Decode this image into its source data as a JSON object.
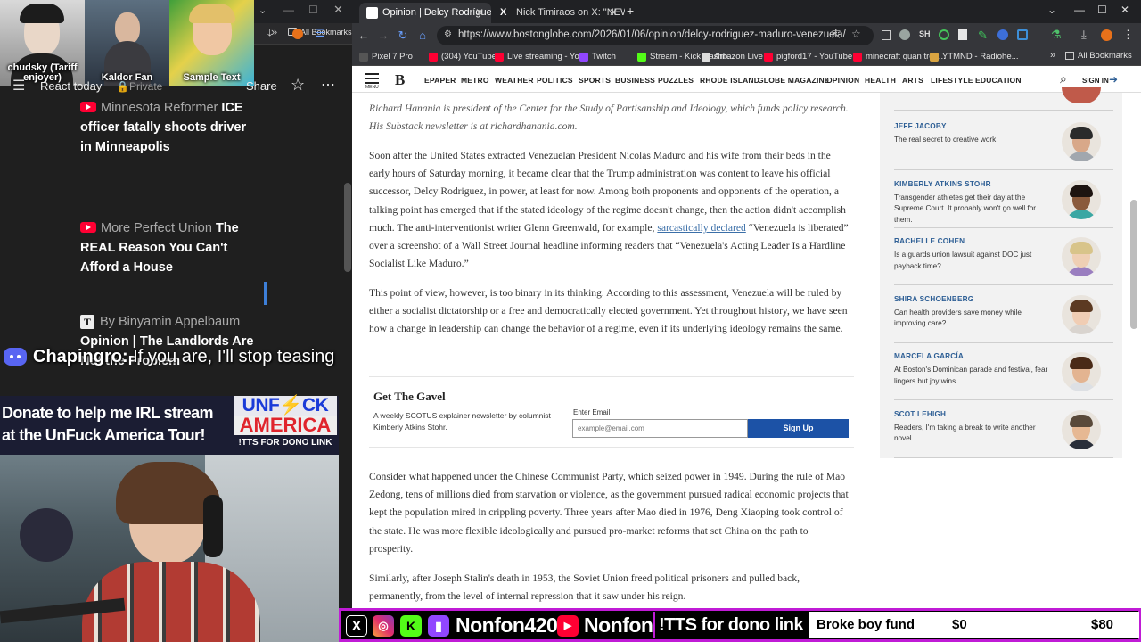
{
  "left_window": {
    "thumbnails": [
      {
        "caption": "chudsky (Tariff enjoyer)"
      },
      {
        "caption": "Kaldor Fan"
      },
      {
        "caption": "Sample Text"
      }
    ],
    "bookmarks_label": "All Bookmarks",
    "youtube_bar": {
      "react_label": "React today",
      "private_label": "Private",
      "share_label": "Share"
    },
    "feed": [
      {
        "source": "Minnesota Reformer",
        "title": "ICE officer fatally shoots driver in Minneapolis"
      },
      {
        "source": "More Perfect Union",
        "title": "The REAL Reason You Can't Afford a House"
      },
      {
        "source": "By Binyamin Appelbaum",
        "title": "Opinion | The Landlords Are Not the Problem"
      }
    ]
  },
  "overlays": {
    "chat_user": "Chapingro:",
    "chat_message": "If you are, I'll stop teasing",
    "donate_line1": "Donate to help me  IRL stream",
    "donate_line2": "at the UnFuck America Tour!",
    "logo_line1": "UNF⚡CK",
    "logo_line2": "AMERICA",
    "tts_label": "!TTS FOR DONO LINK"
  },
  "browser": {
    "tabs": [
      {
        "label": "Opinion | Delcy Rodríguez and",
        "active": true
      },
      {
        "label": "Nick Timiraos on X: \"NEW: Trur",
        "active": false
      }
    ],
    "url": "https://www.bostonglobe.com/2026/01/06/opinion/delcy-rodriguez-maduro-venezuela/",
    "bookmarks": [
      {
        "label": "Pixel 7 Pro",
        "color": "#555555"
      },
      {
        "label": "(304) YouTube",
        "color": "#ff0033"
      },
      {
        "label": "Live streaming - Yo...",
        "color": "#ff0033"
      },
      {
        "label": "Twitch",
        "color": "#9146ff"
      },
      {
        "label": "Stream - Kick Dashb...",
        "color": "#53fc18"
      },
      {
        "label": "Amazon Live",
        "color": "#dddddd"
      },
      {
        "label": "pigford17 - YouTube",
        "color": "#ff0033"
      },
      {
        "label": "minecraft quan tron...",
        "color": "#ff0033"
      },
      {
        "label": "YTMND - Radiohe...",
        "color": "#d9a441"
      }
    ],
    "all_bookmarks": "All Bookmarks"
  },
  "site": {
    "logo": "B",
    "menu_label": "MENU",
    "nav": [
      "EPAPER",
      "METRO",
      "WEATHER",
      "POLITICS",
      "SPORTS",
      "BUSINESS",
      "PUZZLES",
      "RHODE ISLAND",
      "GLOBE MAGAZINE",
      "OPINION",
      "HEALTH",
      "ARTS",
      "LIFESTYLE",
      "EDUCATION"
    ],
    "sign_in": "SIGN IN"
  },
  "article": {
    "bio": "Richard Hanania is president of the Center for the Study of Partisanship and Ideology, which funds policy research. His Substack newsletter is at richardhanania.com.",
    "p1_before": "Soon after the United States extracted Venezuelan President Nicolás Maduro and his wife from their beds in the early hours of Saturday morning, it became clear that the Trump administration was content to leave his official successor, Delcy Rodriguez, in power, at least for now. Among both proponents and opponents of the operation, a talking point has emerged that if the stated ideology of the regime doesn't change, then the action didn't accomplish much. The anti-interventionist writer Glenn Greenwald, for example, ",
    "p1_link": "sarcastically declared",
    "p1_after": " “Venezuela is liberated” over a screenshot of a Wall Street Journal headline informing readers that “Venezuela's Acting Leader Is a Hardline Socialist Like Maduro.”",
    "p2": "This point of view, however, is too binary in its thinking. According to this assessment, Venezuela will be ruled by either a socialist dictatorship or a free and democratically elected government. Yet throughout history, we have seen how a change in leadership can change the behavior of a regime, even if its underlying ideology remains the same.",
    "p3": "Consider what happened under the Chinese Communist Party, which seized power in 1949. During the rule of Mao Zedong, tens of millions died from starvation or violence, as the government pursued radical economic projects that kept the population mired in crippling poverty. Three years after Mao died in 1976, Deng Xiaoping took control of the state. He was more flexible ideologically and pursued pro-market reforms that set China on the path to prosperity.",
    "p4": "Similarly, after Joseph Stalin's death in 1953, the Soviet Union freed political prisoners and pulled back, permanently, from the level of internal repression that it saw under his reign."
  },
  "newsletter": {
    "title": "Get The Gavel",
    "description": "A weekly SCOTUS explainer newsletter by columnist Kimberly Atkins Stohr.",
    "email_label": "Enter Email",
    "email_placeholder": "example@email.com",
    "signup": "Sign Up"
  },
  "sidebar": [
    {
      "name": "JEFF JACOBY",
      "title": "The real secret to creative work",
      "skin": "#d8a889",
      "hair": "#2b2b2b",
      "shirt": "#a1a7ae"
    },
    {
      "name": "KIMBERLY ATKINS STOHR",
      "title": "Transgender athletes get their day at the Supreme Court. It probably won't go well for them.",
      "skin": "#8a5a3c",
      "hair": "#1e1410",
      "shirt": "#3aa7a3"
    },
    {
      "name": "RACHELLE COHEN",
      "title": "Is a guards union lawsuit against DOC just payback time?",
      "skin": "#efcfb4",
      "hair": "#d8c48a",
      "shirt": "#9a7ec0"
    },
    {
      "name": "SHIRA SCHOENBERG",
      "title": "Can health providers save money while improving care?",
      "skin": "#f0cdb4",
      "hair": "#5c3a22",
      "shirt": "#d9d4cf"
    },
    {
      "name": "MARCELA GARCÍA",
      "title": "At Boston's Dominican parade and festival, fear lingers but joy wins",
      "skin": "#e3b491",
      "hair": "#4a2a17",
      "shirt": "#dde0e4"
    },
    {
      "name": "SCOT LEHIGH",
      "title": "Readers, I'm taking a break to write another novel",
      "skin": "#e6b893",
      "hair": "#5a4a3a",
      "shirt": "#2a2f3a"
    }
  ],
  "stream_bar": {
    "handle1": "Nonfon420",
    "handle2": "Nonfon",
    "tts": "!TTS for dono link",
    "goal_label": "Broke boy fund",
    "goal_current": "$0",
    "goal_target": "$80"
  }
}
